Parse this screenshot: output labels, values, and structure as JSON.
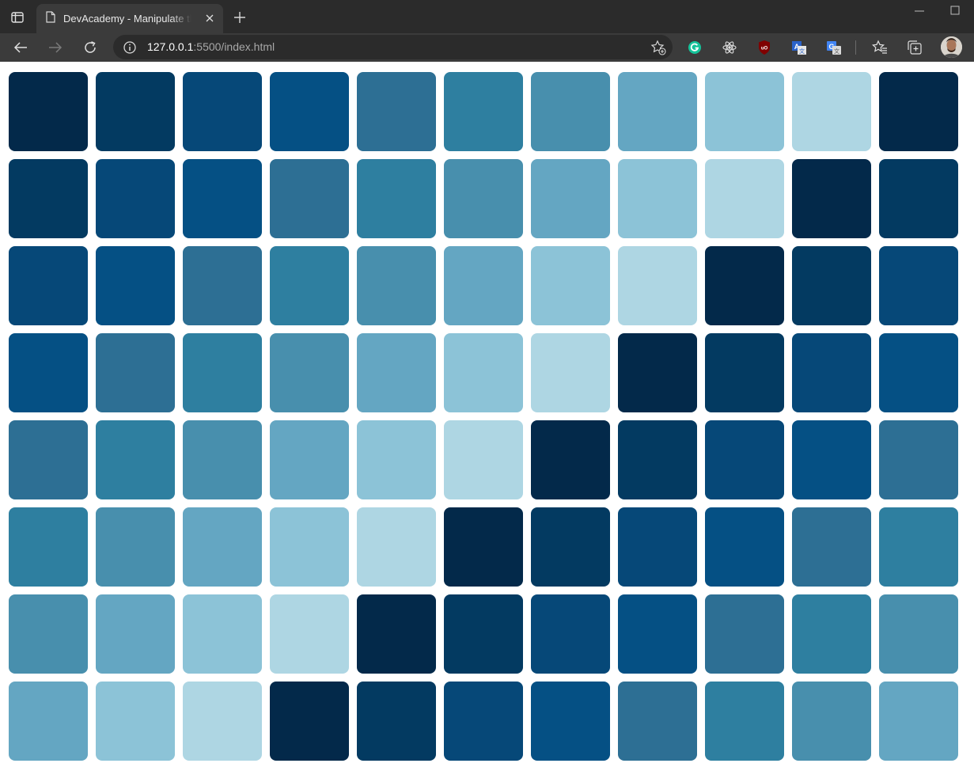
{
  "browser": {
    "tab_title": "DevAcademy - Manipulate the DOM",
    "url_host": "127.0.0.1",
    "url_rest": ":5500/index.html"
  },
  "palette": [
    "#03294a",
    "#033a61",
    "#064878",
    "#055084",
    "#2d6f94",
    "#2e7fa0",
    "#488fad",
    "#64a6c2",
    "#8cc3d7",
    "#aed6e3"
  ],
  "grid": {
    "columns": 11,
    "rows": 8,
    "rule": "square color = palette[(row + column) mod 10]"
  }
}
